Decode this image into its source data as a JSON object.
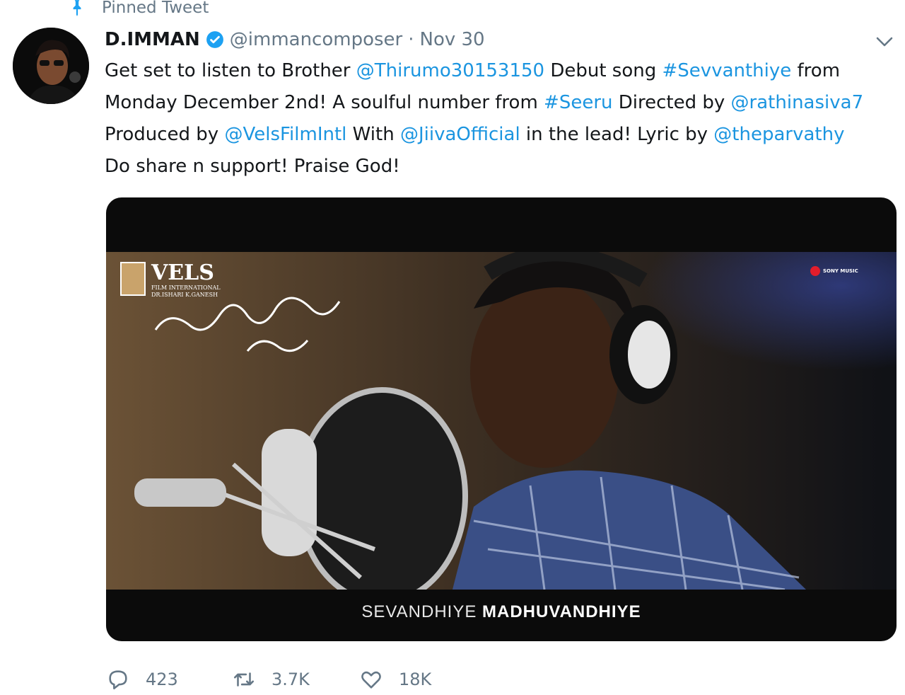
{
  "pinned_label": "Pinned Tweet",
  "author": {
    "name": "D.IMMAN",
    "handle": "@immancomposer",
    "separator": "·",
    "date": "Nov 30"
  },
  "tweet": {
    "lines": [
      [
        {
          "t": "Get set to listen to Brother ",
          "link": false
        },
        {
          "t": "@Thirumo30153150",
          "link": true
        },
        {
          "t": " Debut song ",
          "link": false
        },
        {
          "t": "#Sevvanthiye",
          "link": true
        },
        {
          "t": " from",
          "link": false
        }
      ],
      [
        {
          "t": "Monday December 2nd! A soulful number from ",
          "link": false
        },
        {
          "t": "#Seeru",
          "link": true
        },
        {
          "t": " Directed by ",
          "link": false
        },
        {
          "t": "@rathinasiva7",
          "link": true
        }
      ],
      [
        {
          "t": "Produced by ",
          "link": false
        },
        {
          "t": "@VelsFilmIntl",
          "link": true
        },
        {
          "t": " With ",
          "link": false
        },
        {
          "t": "@JiivaOfficial",
          "link": true
        },
        {
          "t": " in the lead! Lyric by ",
          "link": false
        },
        {
          "t": "@theparvathy",
          "link": true
        }
      ],
      [
        {
          "t": "Do share n support! Praise God!",
          "link": false
        }
      ]
    ]
  },
  "media": {
    "logo_text": "VELS",
    "logo_sub": "FILM INTERNATIONAL",
    "logo_sub2": "DR.ISHARI K.GANESH",
    "label_brand": "SONY MUSIC",
    "subtitle_light": "SEVANDHIYE ",
    "subtitle_bold": "MADHUVANDHIYE"
  },
  "actions": {
    "replies": "423",
    "retweets": "3.7K",
    "likes": "18K"
  },
  "colors": {
    "link": "#1b95e0",
    "muted": "#657786",
    "text": "#14171a",
    "verified": "#1da1f2"
  },
  "icons": [
    "pin-icon",
    "verified-icon",
    "chevron-down-icon",
    "reply-icon",
    "retweet-icon",
    "like-icon"
  ]
}
